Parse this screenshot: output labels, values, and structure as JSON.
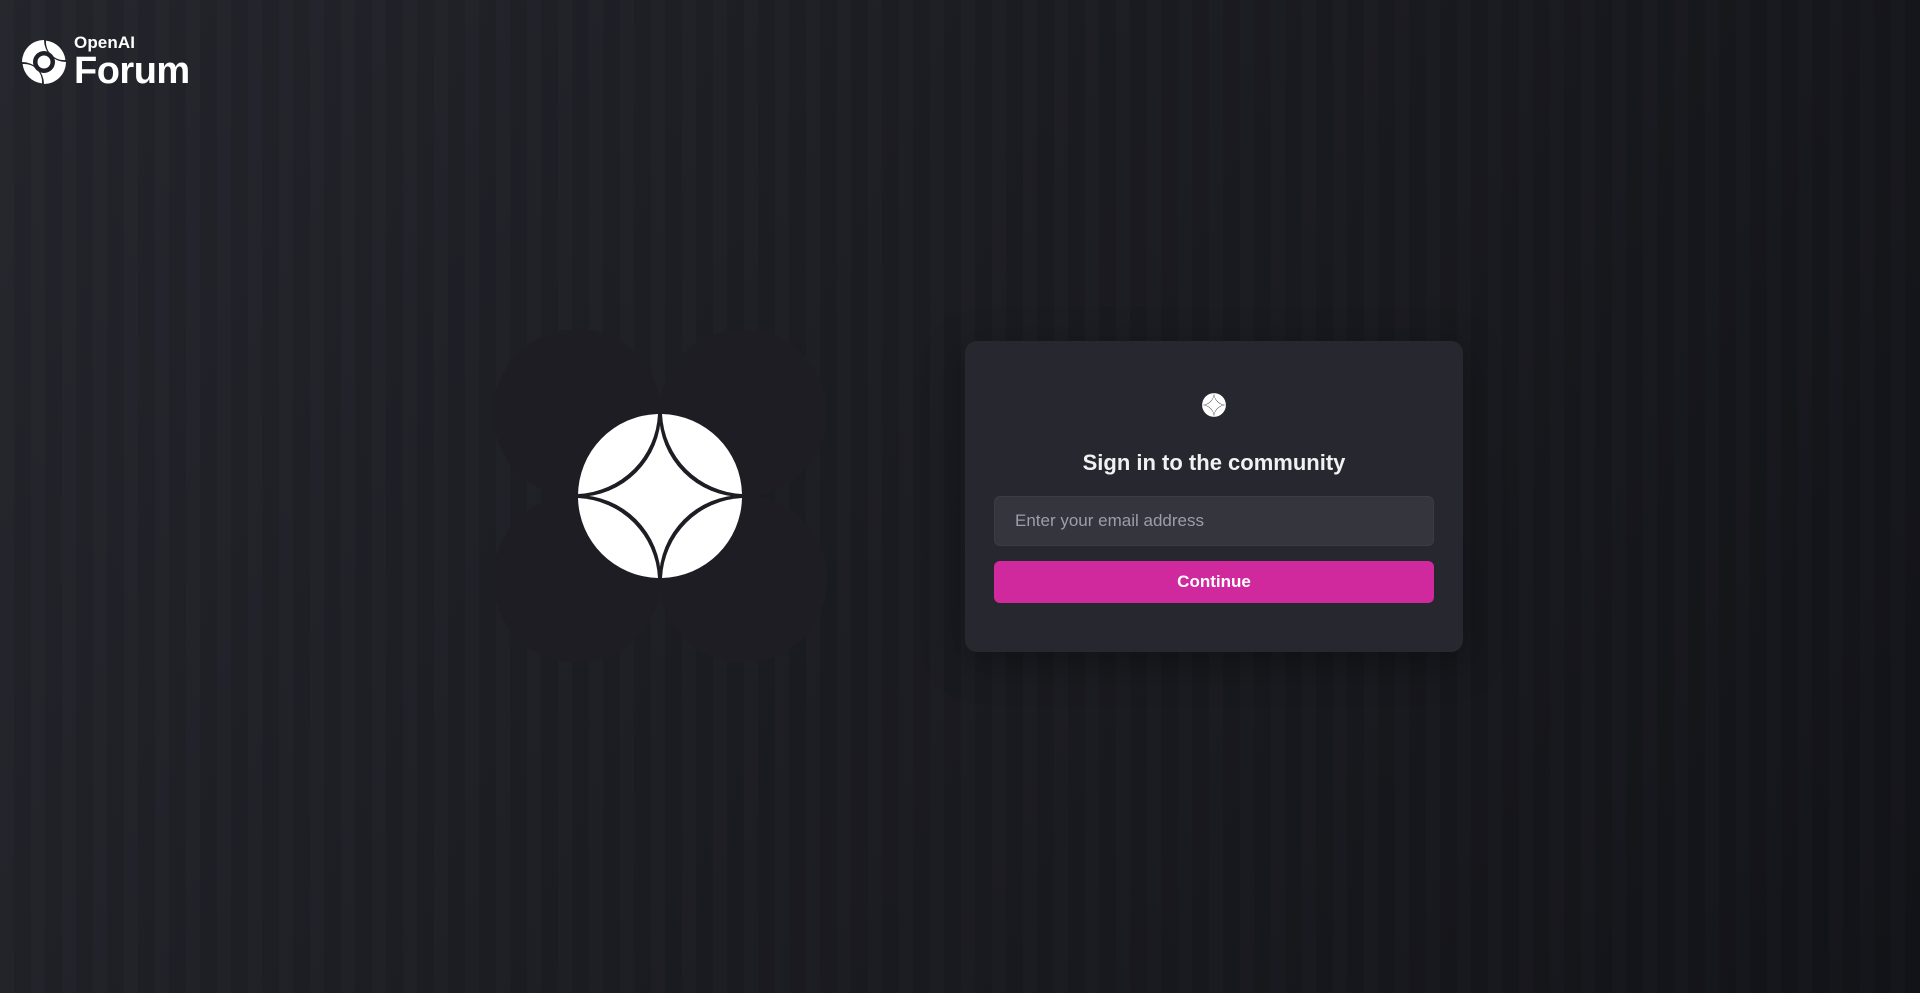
{
  "header": {
    "brand_small": "OpenAI",
    "brand_big": "Forum",
    "logo_icon": "openai-forum-logo-icon"
  },
  "hero": {
    "icon": "openai-forum-emblem-icon"
  },
  "login": {
    "icon": "openai-forum-logo-icon",
    "title": "Sign in to the community",
    "email_placeholder": "Enter your email address",
    "email_value": "",
    "continue_label": "Continue"
  },
  "colors": {
    "background": "#1b1c22",
    "card": "#27282f",
    "input": "#34353d",
    "accent": "#d0299e",
    "ring": "#565770"
  }
}
